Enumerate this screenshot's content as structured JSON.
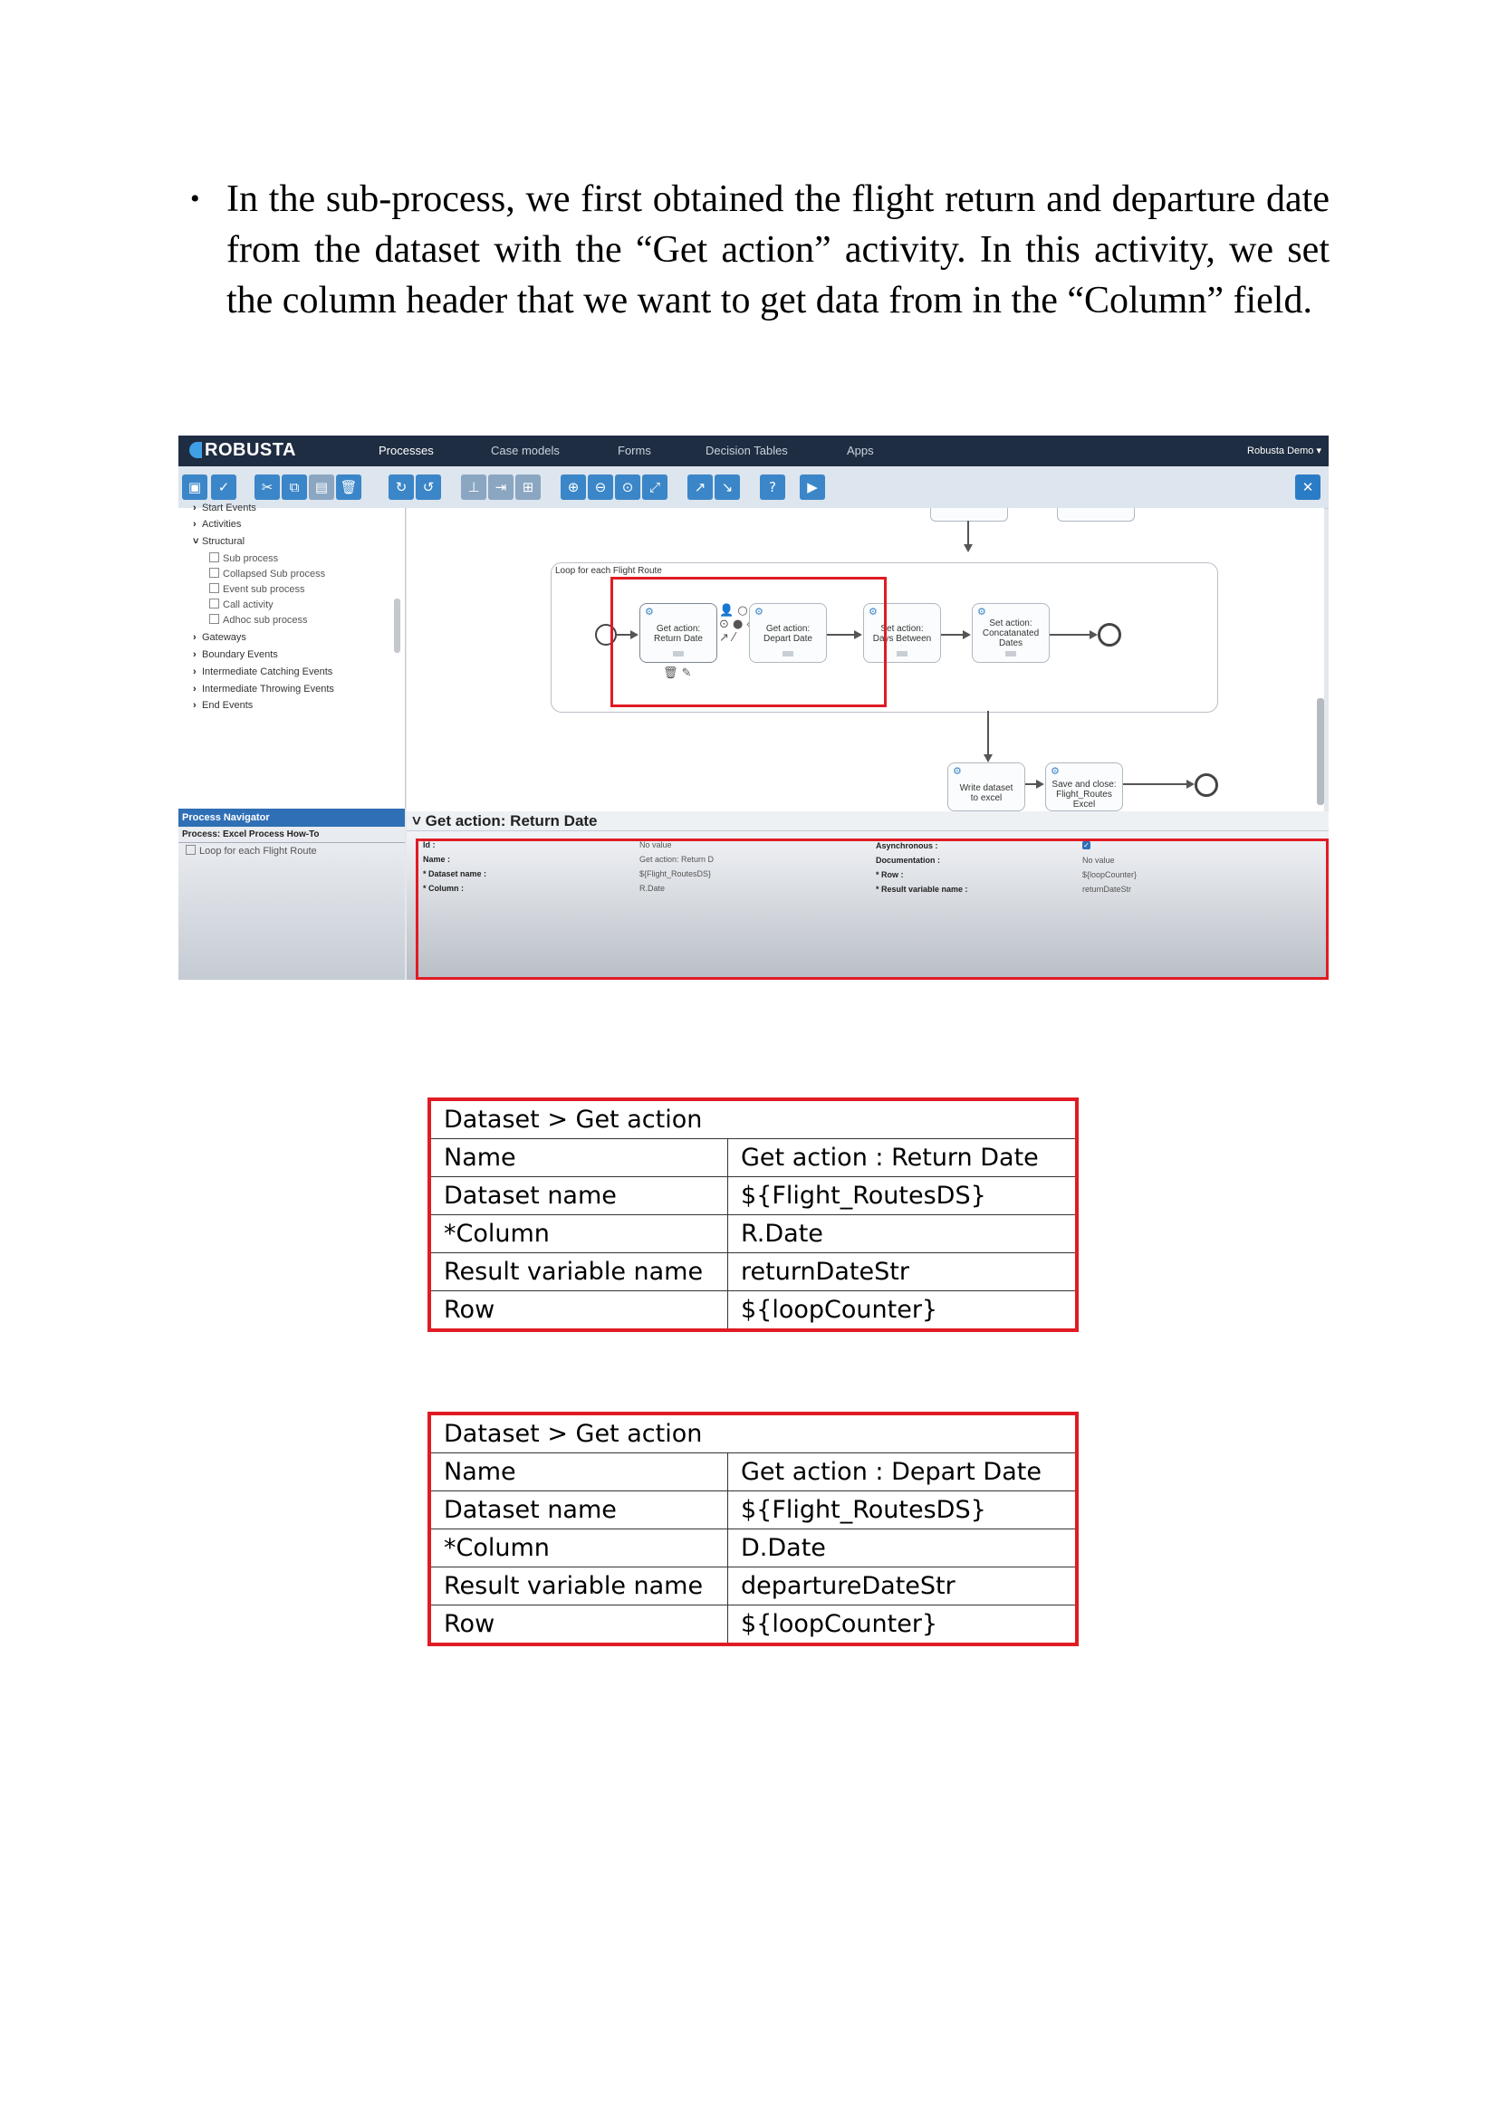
{
  "paragraph": {
    "bullet": "•",
    "text": "In the sub-process, we first obtained the flight return and departure date from the dataset with the “Get action” activity. In this activity, we set the column header that we want to get data from in the “Column” field."
  },
  "screenshot": {
    "logo": "ROBUSTA",
    "nav": [
      "Processes",
      "Case models",
      "Forms",
      "Decision Tables",
      "Apps"
    ],
    "user_menu": "Robusta Demo ▾",
    "palette": {
      "groups": [
        "Start Events",
        "Activities",
        "Structural",
        "Gateways",
        "Boundary Events",
        "Intermediate Catching Events",
        "Intermediate Throwing Events",
        "End Events"
      ],
      "structural_items": [
        "Sub process",
        "Collapsed Sub process",
        "Event sub process",
        "Call activity",
        "Adhoc sub process"
      ]
    },
    "navigator": {
      "title": "Process Navigator",
      "process": "Process: Excel Process How-To",
      "child": "Loop for each Flight Route"
    },
    "diagram": {
      "pool_label": "Loop for each Flight Route",
      "tasks": {
        "return_date": "Get action:\nReturn Date",
        "depart_date": "Get action:\nDepart Date",
        "days_between": "Set action:\nDays Between",
        "concat_dates": "Set action:\nConcatanated\nDates",
        "write_excel": "Write dataset\nto excel",
        "save_close": "Save and close:\nFlight_Routes\nExcel"
      }
    },
    "properties": {
      "title": "Get action: Return Date",
      "fields": {
        "id_label": "Id :",
        "id_value": "No value",
        "name_label": "Name :",
        "name_value": "Get action: Return D",
        "dataset_label": "* Dataset name :",
        "dataset_value": "${Flight_RoutesDS}",
        "column_label": "* Column :",
        "column_value": "R.Date",
        "async_label": "Asynchronous :",
        "doc_label": "Documentation :",
        "doc_value": "No value",
        "row_label": "* Row :",
        "row_value": "${loopCounter}",
        "result_label": "* Result variable name :",
        "result_value": "returnDateStr"
      }
    }
  },
  "tables": [
    {
      "header": "Dataset  > Get action",
      "rows": [
        [
          "Name",
          "Get action : Return Date"
        ],
        [
          "Dataset name",
          "${Flight_RoutesDS}"
        ],
        [
          "*Column",
          "R.Date"
        ],
        [
          "Result variable name",
          "returnDateStr"
        ],
        [
          "Row",
          "${loopCounter}"
        ]
      ]
    },
    {
      "header": "Dataset  > Get action",
      "rows": [
        [
          "Name",
          "Get action : Depart Date"
        ],
        [
          "Dataset name",
          "${Flight_RoutesDS}"
        ],
        [
          "*Column",
          "D.Date"
        ],
        [
          "Result variable name",
          "departureDateStr"
        ],
        [
          "Row",
          "${loopCounter}"
        ]
      ]
    }
  ],
  "colors": {
    "highlight": "#e01b24",
    "topbar": "#1f2d42",
    "toolbar_button": "#3b86c8"
  }
}
